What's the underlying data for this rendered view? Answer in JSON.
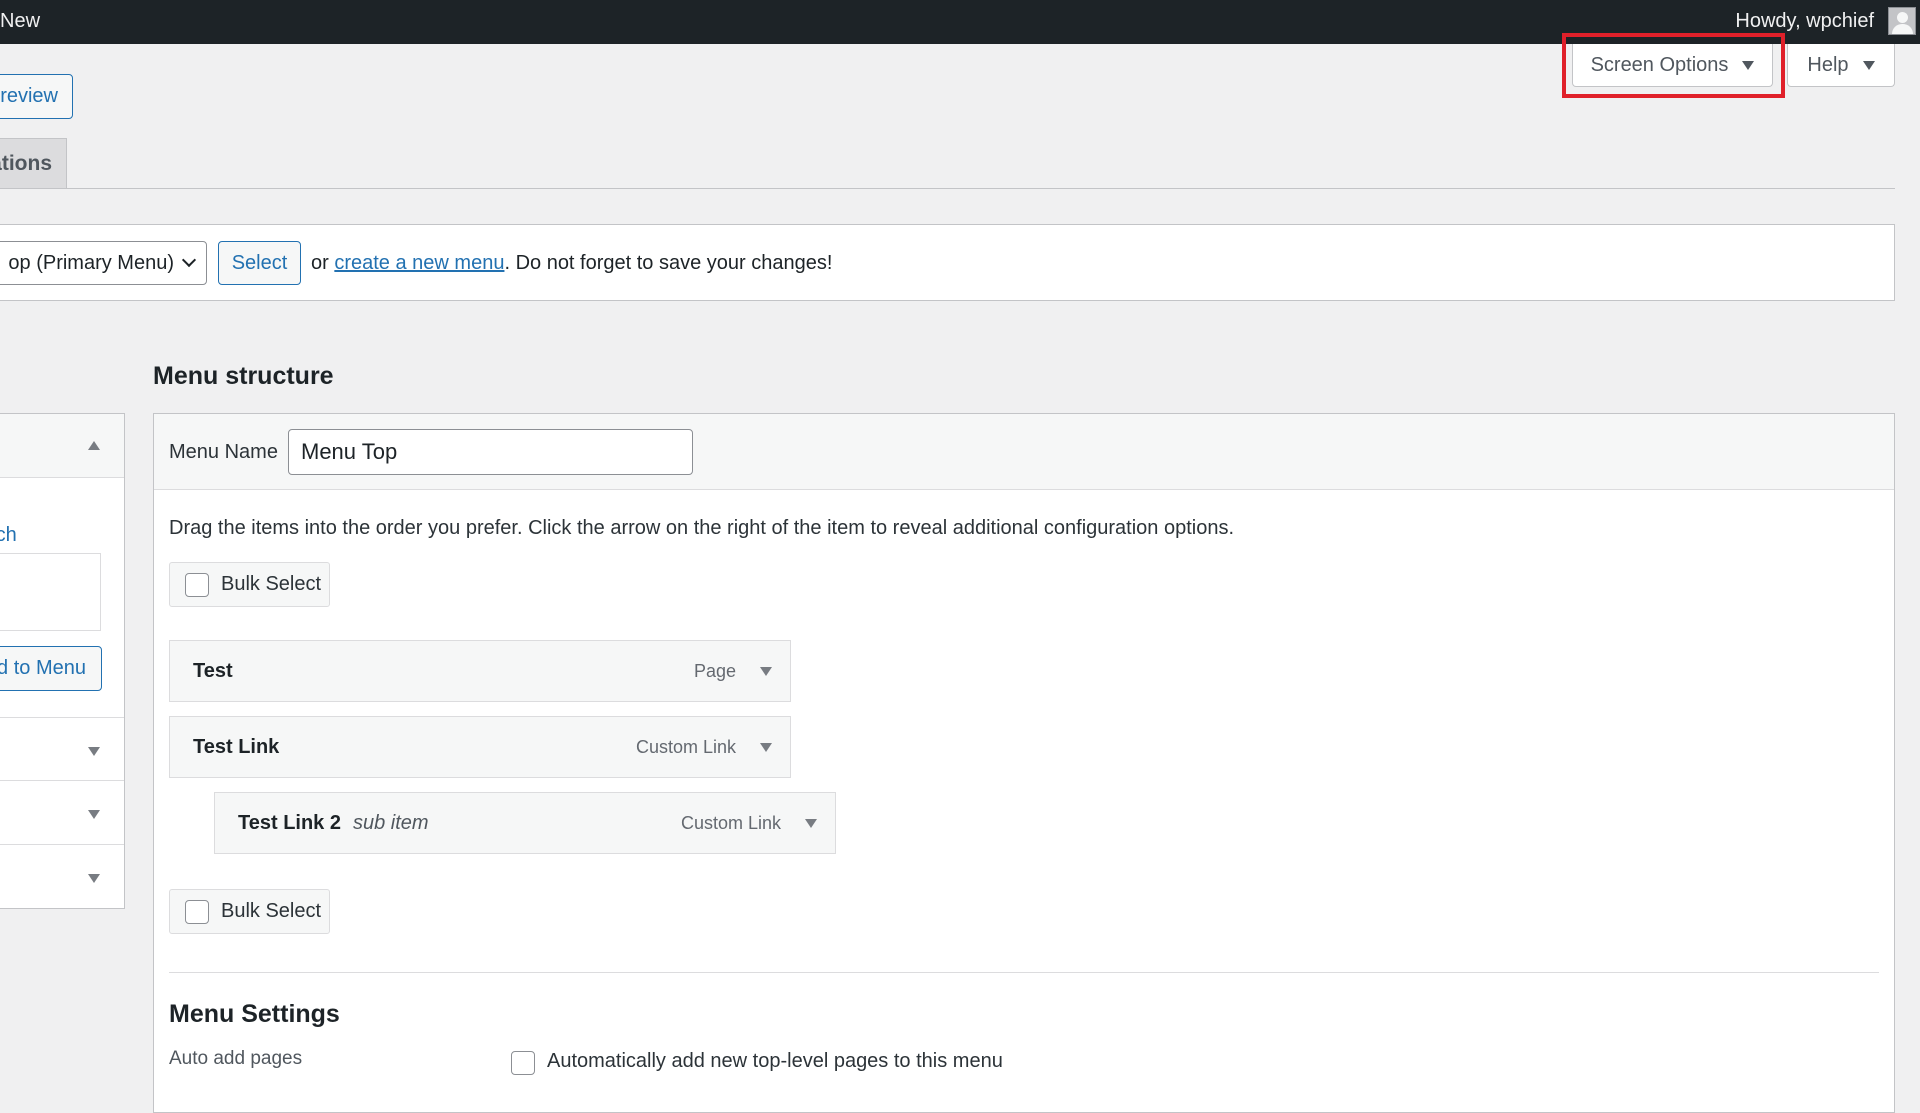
{
  "admin_bar": {
    "new_label": "New",
    "greeting": "Howdy, wpchief",
    "avatar_icon": "user-avatar-icon"
  },
  "screen_meta": {
    "screen_options_label": "Screen Options",
    "help_label": "Help",
    "highlight_color": "#e0202a"
  },
  "header": {
    "preview_button": "Preview",
    "tab_label": "ations"
  },
  "menu_select": {
    "selected_option": "op (Primary Menu)",
    "select_button": "Select",
    "text_before_link": "or ",
    "link_text": "create a new menu",
    "text_after_link": ". Do not forget to save your changes!"
  },
  "left_panel": {
    "search_link": "rch",
    "add_button": "d to Menu",
    "sections": [
      "expanded",
      "collapsed",
      "collapsed",
      "collapsed"
    ]
  },
  "menu_structure": {
    "title": "Menu structure",
    "menu_name_label": "Menu Name",
    "menu_name_value": "Menu Top",
    "instructions": "Drag the items into the order you prefer. Click the arrow on the right of the item to reveal additional configuration options.",
    "bulk_select_label": "Bulk Select",
    "items": [
      {
        "title": "Test",
        "sub": "",
        "type": "Page"
      },
      {
        "title": "Test Link",
        "sub": "",
        "type": "Custom Link"
      },
      {
        "title": "Test Link 2",
        "sub": "sub item",
        "type": "Custom Link"
      }
    ]
  },
  "menu_settings": {
    "title": "Menu Settings",
    "auto_add_label": "Auto add pages",
    "auto_add_option": "Automatically add new top-level pages to this menu",
    "auto_add_checked": false
  },
  "colors": {
    "admin_bar": "#1d2327",
    "accent": "#2271b1",
    "background": "#f0f0f1"
  }
}
